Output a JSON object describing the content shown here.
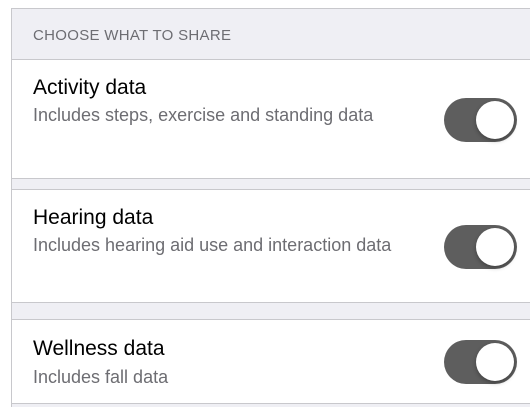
{
  "section": {
    "header": "CHOOSE WHAT TO SHARE"
  },
  "items": [
    {
      "title": "Activity data",
      "description": "Includes steps, exercise and standing data",
      "enabled": true
    },
    {
      "title": "Hearing data",
      "description": "Includes hearing aid use and interaction data",
      "enabled": true
    },
    {
      "title": "Wellness data",
      "description": "Includes fall data",
      "enabled": true
    }
  ],
  "colors": {
    "toggle_on": "#5e5e5e",
    "group_background": "#efeff4",
    "secondary_text": "#6d6d72"
  }
}
